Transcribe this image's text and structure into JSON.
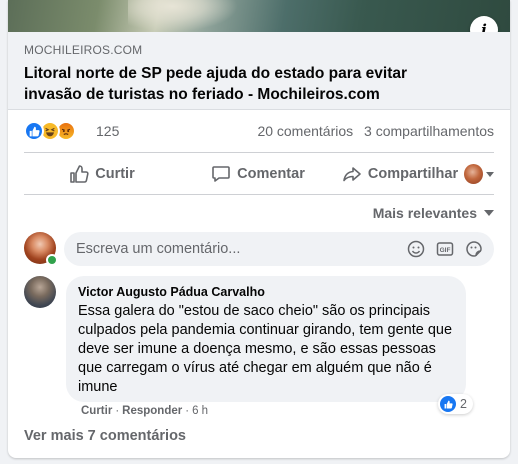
{
  "link_preview": {
    "domain": "MOCHILEIROS.COM",
    "title": "Litoral norte de SP pede ajuda do estado para evitar invasão de turistas no feriado - Mochileiros.com",
    "info_icon": "i"
  },
  "reactions": {
    "icons": [
      "like-icon",
      "haha-icon",
      "angry-icon"
    ],
    "count": "125",
    "comments": "20 comentários",
    "shares": "3 compartilhamentos"
  },
  "actions": {
    "like": "Curtir",
    "comment": "Comentar",
    "share": "Compartilhar"
  },
  "sort": {
    "label": "Mais relevantes"
  },
  "composer": {
    "placeholder": "Escreva um comentário...",
    "icons": [
      "emoji-icon",
      "gif-icon",
      "sticker-icon"
    ]
  },
  "comment": {
    "author": "Victor Augusto Pádua Carvalho",
    "text": "Essa galera do \"estou de saco cheio\" são os principais culpados pela pandemia continuar girando, tem gente que deve ser imune a doença mesmo, e são essas pessoas que carregam o vírus até chegar em alguém que não é imune",
    "reaction_count": "2",
    "like": "Curtir",
    "reply": "Responder",
    "time": "6 h"
  },
  "more_comments": "Ver mais 7 comentários",
  "colors": {
    "accent": "#1877f2",
    "secondary_text": "#65676b",
    "online": "#31a24c"
  }
}
